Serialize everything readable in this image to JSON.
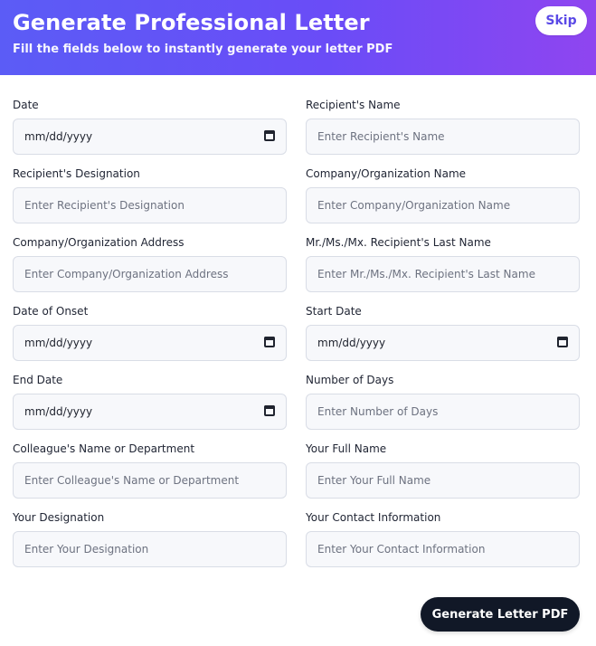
{
  "header": {
    "title": "Generate Professional Letter",
    "subtitle": "Fill the fields below to instantly generate your letter PDF",
    "skip_label": "Skip"
  },
  "fields": [
    {
      "label": "Date",
      "value": "mm/dd/yyyy",
      "placeholder": "",
      "type": "date"
    },
    {
      "label": "Recipient's Name",
      "value": "",
      "placeholder": "Enter Recipient's Name",
      "type": "text"
    },
    {
      "label": "Recipient's Designation",
      "value": "",
      "placeholder": "Enter Recipient's Designation",
      "type": "text"
    },
    {
      "label": "Company/Organization Name",
      "value": "",
      "placeholder": "Enter Company/Organization Name",
      "type": "text"
    },
    {
      "label": "Company/Organization Address",
      "value": "",
      "placeholder": "Enter Company/Organization Address",
      "type": "text"
    },
    {
      "label": "Mr./Ms./Mx. Recipient's Last Name",
      "value": "",
      "placeholder": "Enter Mr./Ms./Mx. Recipient's Last Name",
      "type": "text"
    },
    {
      "label": "Date of Onset",
      "value": "mm/dd/yyyy",
      "placeholder": "",
      "type": "date"
    },
    {
      "label": "Start Date",
      "value": "mm/dd/yyyy",
      "placeholder": "",
      "type": "date"
    },
    {
      "label": "End Date",
      "value": "mm/dd/yyyy",
      "placeholder": "",
      "type": "date"
    },
    {
      "label": "Number of Days",
      "value": "",
      "placeholder": "Enter Number of Days",
      "type": "text"
    },
    {
      "label": "Colleague's Name or Department",
      "value": "",
      "placeholder": "Enter Colleague's Name or Department",
      "type": "text"
    },
    {
      "label": "Your Full Name",
      "value": "",
      "placeholder": "Enter Your Full Name",
      "type": "text"
    },
    {
      "label": "Your Designation",
      "value": "",
      "placeholder": "Enter Your Designation",
      "type": "text"
    },
    {
      "label": "Your Contact Information",
      "value": "",
      "placeholder": "Enter Your Contact Information",
      "type": "text"
    }
  ],
  "actions": {
    "generate_label": "Generate Letter PDF"
  }
}
